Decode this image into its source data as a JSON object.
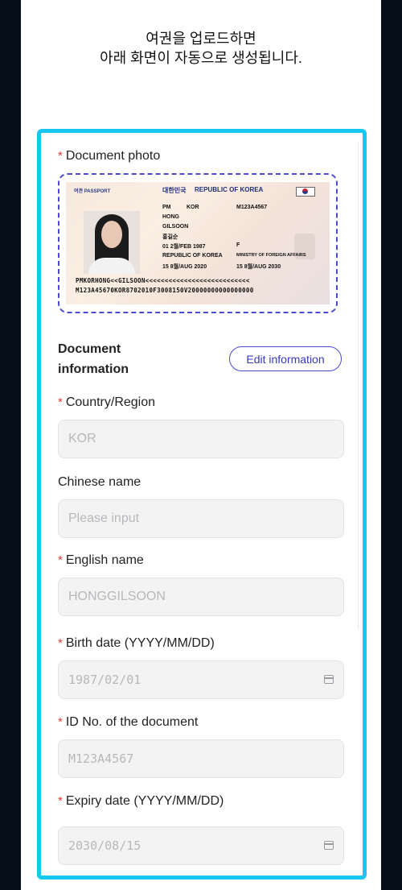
{
  "intro": {
    "line1": "여권을 업로드하면",
    "line2": "아래 화면이 자동으로 생성됩니다."
  },
  "colors": {
    "highlight": "#17c7f0",
    "accent": "#4b4ad0",
    "required": "#d83b3b"
  },
  "form": {
    "document_photo_label": "Document photo",
    "passport": {
      "header_left": "여권  PASSPORT",
      "header_country_kr": "대한민국",
      "header_country_en": "REPUBLIC OF KOREA",
      "type": "PM",
      "issuing_country": "KOR",
      "passport_no": "M123A4567",
      "surname": "HONG",
      "given_names": "GILSOON",
      "name_kr": "홍길순",
      "birth_date": "01 2월/FEB 1987",
      "sex": "F",
      "nationality": "REPUBLIC OF KOREA",
      "authority": "MINISTRY OF FOREIGN AFFAIRS",
      "date_of_issue": "15 8월/AUG 2020",
      "date_of_expiry": "15 8월/AUG 2030",
      "mrz_line1": "PMKORHONG<<GILSOON<<<<<<<<<<<<<<<<<<<<<<<<<<<",
      "mrz_line2": "M123A45670KOR8702010F3008150V20000000000000000"
    },
    "document_info_title": "Document information",
    "edit_button": "Edit information",
    "country": {
      "label": "Country/Region",
      "value": "KOR"
    },
    "chinese_name": {
      "label": "Chinese name",
      "placeholder": "Please input"
    },
    "english_name": {
      "label": "English name",
      "value": "HONGGILSOON"
    },
    "birth_date": {
      "label": "Birth date (YYYY/MM/DD)",
      "value": "1987/02/01"
    },
    "id_no": {
      "label": "ID No. of the document",
      "value": "M123A4567"
    },
    "expiry_date": {
      "label": "Expiry date (YYYY/MM/DD)",
      "value": "2030/08/15"
    },
    "required_mark": "*"
  }
}
